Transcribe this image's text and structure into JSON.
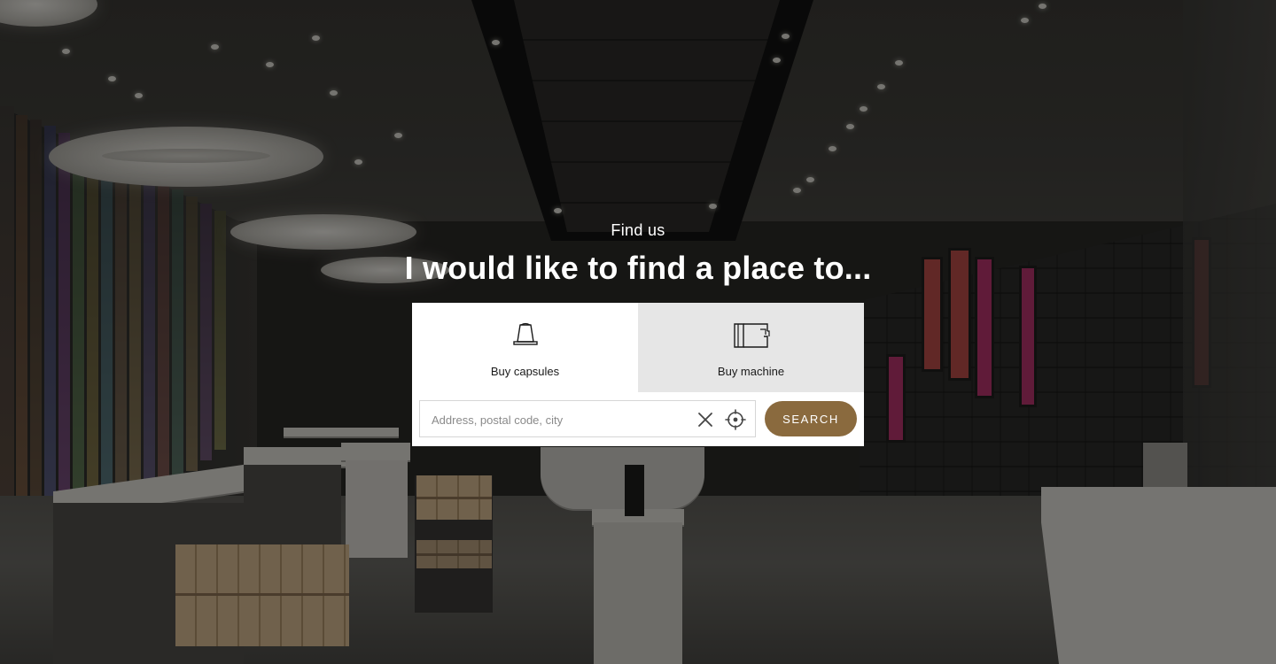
{
  "hero": {
    "eyebrow": "Find us",
    "headline": "I would like to find a place to..."
  },
  "finder": {
    "tabs": [
      {
        "label": "Buy capsules",
        "icon": "capsule-icon",
        "active": true
      },
      {
        "label": "Buy machine",
        "icon": "coffee-machine-icon",
        "active": false
      }
    ],
    "search": {
      "placeholder": "Address, postal code, city",
      "value": "",
      "clear_icon": "close-icon",
      "locate_icon": "crosshair-icon",
      "button_label": "SEARCH"
    }
  },
  "colors": {
    "accent": "#8a6a3e",
    "inactive_tab": "#e6e6e6",
    "text_on_dark": "#ffffff"
  }
}
